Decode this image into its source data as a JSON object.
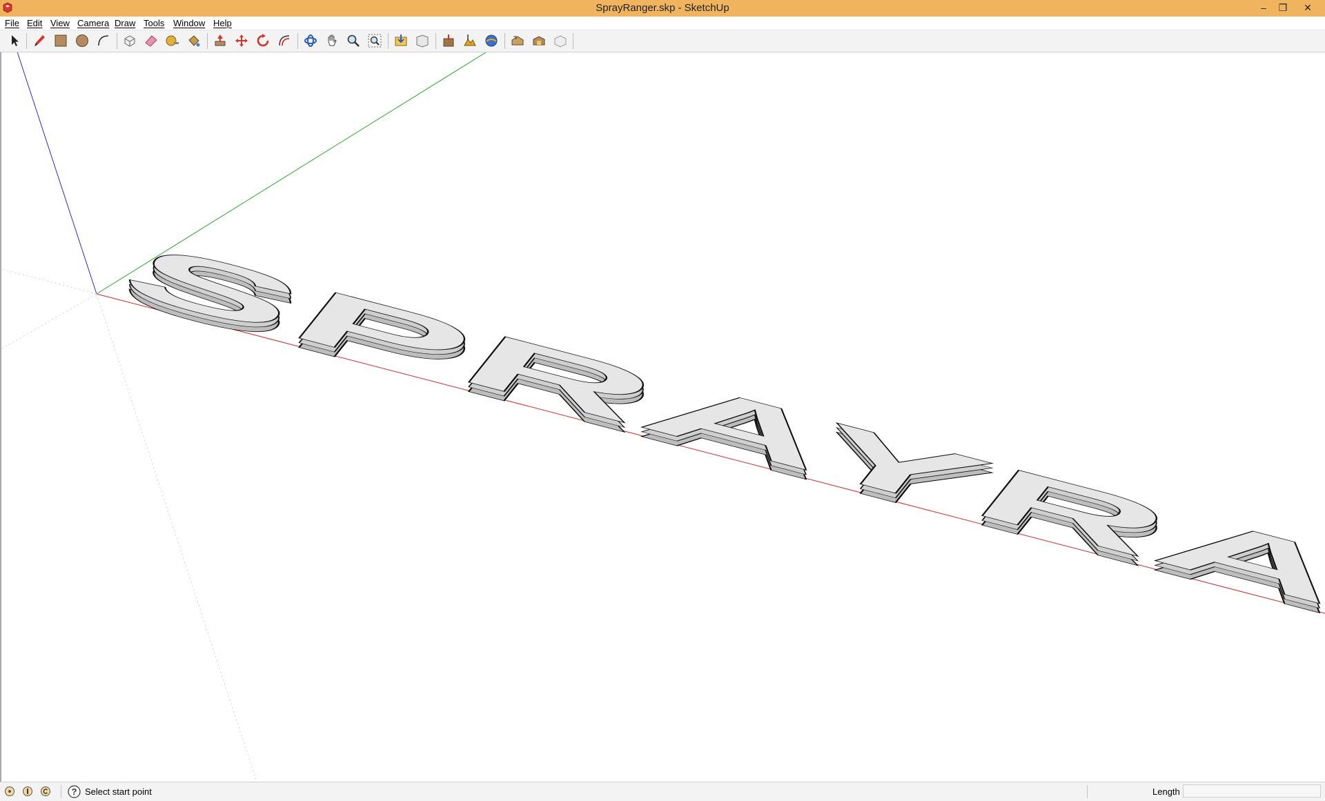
{
  "window": {
    "title": "SprayRanger.skp - SketchUp",
    "controls": {
      "minimize": "–",
      "restore": "❐",
      "close": "✕"
    }
  },
  "menubar": {
    "items": [
      "File",
      "Edit",
      "View",
      "Camera",
      "Draw",
      "Tools",
      "Window",
      "Help"
    ]
  },
  "toolbar": {
    "tools": [
      "select-icon",
      "pencil-icon",
      "rectangle-icon",
      "circle-icon",
      "arc-icon",
      "make-component-icon",
      "eraser-icon",
      "tape-measure-icon",
      "paint-bucket-icon",
      "push-pull-icon",
      "move-icon",
      "rotate-icon",
      "offset-icon",
      "orbit-icon",
      "pan-icon",
      "zoom-icon",
      "zoom-extents-icon",
      "get-models-icon",
      "share-model-icon",
      "add-location-icon",
      "toggle-terrain-icon",
      "preview-google-earth-icon",
      "get-photo-texture-icon",
      "extension-warehouse-icon",
      "layout-icon"
    ]
  },
  "model": {
    "text": "SPRAYRANGER",
    "axis_colors": {
      "red": "#d42b2b",
      "green": "#2ba82b",
      "blue": "#2b2bd4"
    },
    "face_color": "#e6e6e6",
    "side_color": "#bdbdbd"
  },
  "statusbar": {
    "hint": "Select start point",
    "length_label": "Length",
    "length_value": ""
  }
}
